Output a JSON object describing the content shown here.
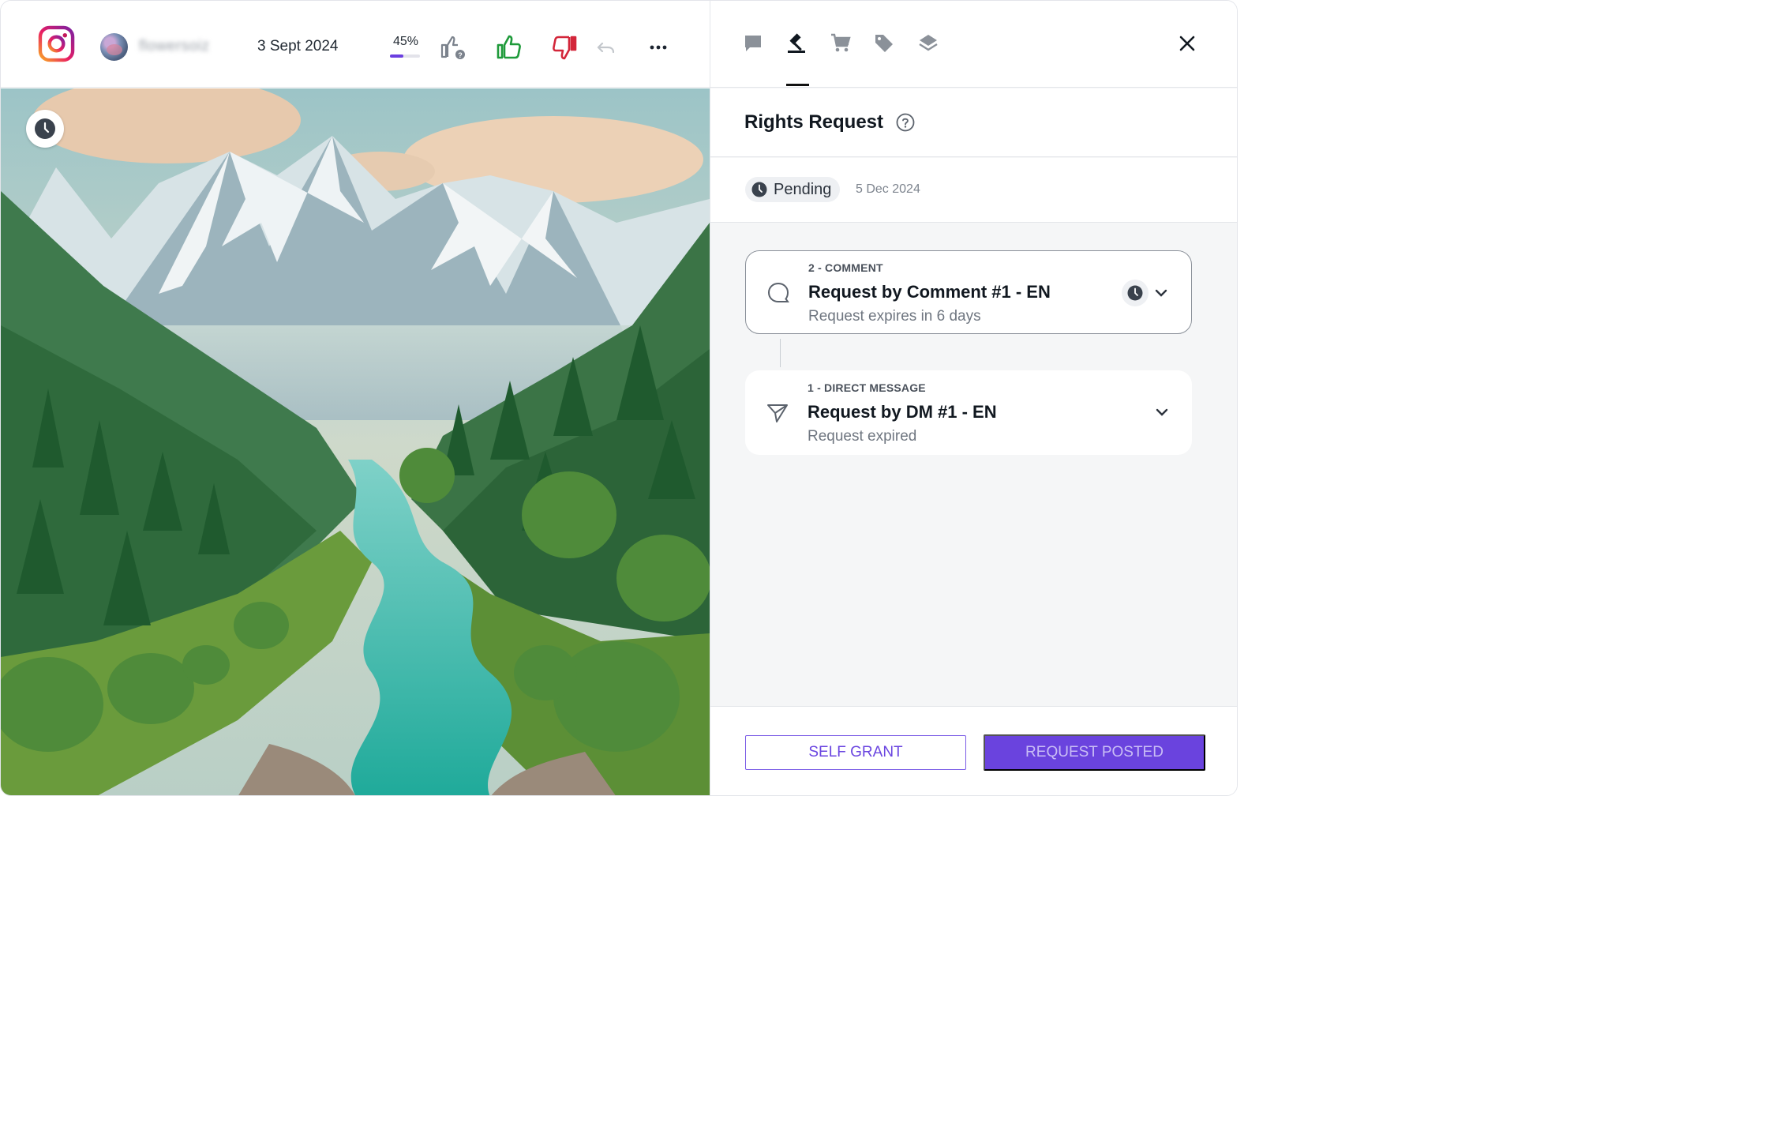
{
  "header": {
    "platform_icon": "instagram-logo",
    "username": "flowersoiz",
    "post_date": "3 Sept 2024",
    "score_label": "45%",
    "score_fraction": 0.45,
    "actions": [
      "thumbs-up-question-icon",
      "thumbs-up-icon",
      "thumbs-down-icon",
      "undo-icon",
      "more-icon"
    ]
  },
  "image": {
    "badge_icon": "clock-icon"
  },
  "panel": {
    "tabs": [
      "comments-icon",
      "gavel-icon",
      "cart-icon",
      "tag-icon",
      "layers-icon"
    ],
    "active_tab": "gavel-icon",
    "close_icon": "close-icon",
    "title": "Rights Request",
    "help_icon": "help-circle-icon",
    "status": {
      "label": "Pending",
      "date": "5 Dec 2024"
    },
    "requests": [
      {
        "kicker": "2 - COMMENT",
        "title": "Request by Comment #1 - EN",
        "subtitle": "Request expires in 6 days",
        "icon": "comment-icon",
        "active": true
      },
      {
        "kicker": "1 - DIRECT MESSAGE",
        "title": "Request by DM #1 - EN",
        "subtitle": "Request expired",
        "icon": "send-icon",
        "active": false
      }
    ],
    "footer": {
      "self_grant": "SELF GRANT",
      "request_posted": "REQUEST POSTED"
    }
  },
  "colors": {
    "accent": "#6a43de",
    "thumbs_up": "#1e9a3a",
    "thumbs_down": "#d3263a"
  }
}
